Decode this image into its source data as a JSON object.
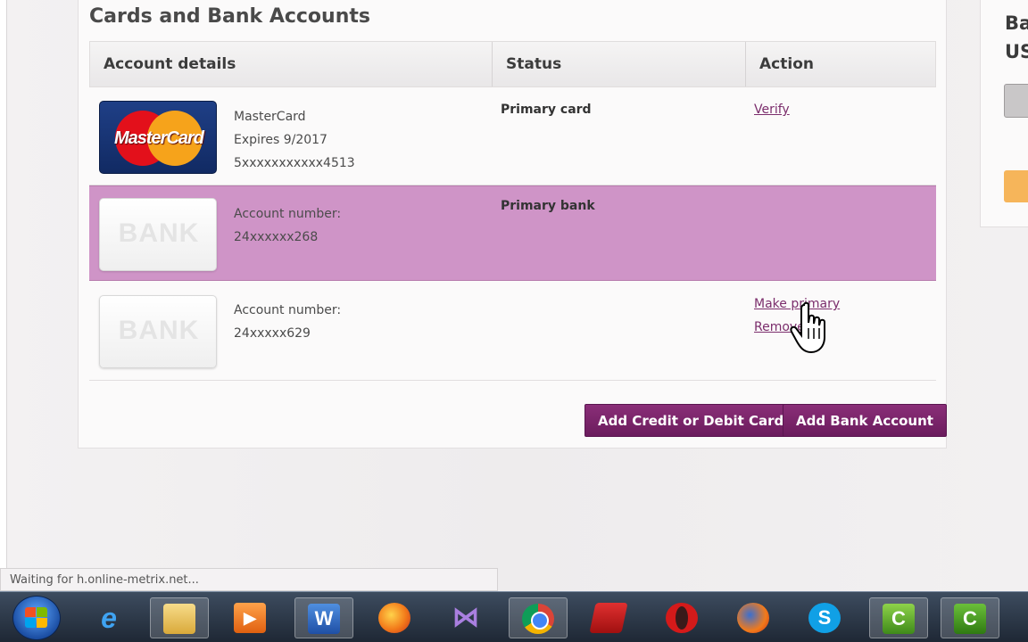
{
  "panel": {
    "title": "Cards and Bank Accounts"
  },
  "table": {
    "headers": {
      "details": "Account details",
      "status": "Status",
      "action": "Action"
    },
    "rows": [
      {
        "logo": "MasterCard",
        "details": [
          "MasterCard",
          "Expires 9/2017",
          "5xxxxxxxxxxx4513"
        ],
        "status": "Primary card",
        "actions": [
          "Verify"
        ]
      },
      {
        "logo": "BANK",
        "details": [
          "Account number:",
          "24xxxxxx268"
        ],
        "status": "Primary bank",
        "actions": []
      },
      {
        "logo": "BANK",
        "details": [
          "Account number:",
          "24xxxxx629"
        ],
        "status": "",
        "actions": [
          "Make primary",
          "Remove"
        ]
      }
    ]
  },
  "buttons": {
    "add_card": "Add Credit or Debit Card",
    "add_bank": "Add Bank Account"
  },
  "right_panel": {
    "line1": "Ba",
    "line2": "US"
  },
  "browser": {
    "status_text": "Waiting for h.online-metrix.net..."
  },
  "taskbar": {
    "icons": [
      "windows-start-icon",
      "internet-explorer-icon",
      "file-explorer-icon",
      "media-player-icon",
      "word-icon",
      "firefox-icon",
      "visual-studio-icon",
      "chrome-icon",
      "book-icon",
      "opera-icon",
      "firefox-alt-icon",
      "skype-icon",
      "camtasia-icon",
      "camtasia-recorder-icon"
    ]
  },
  "colors": {
    "accent": "#7b2d6c",
    "selected_row": "#cf94c7",
    "button": "#7a2469"
  }
}
